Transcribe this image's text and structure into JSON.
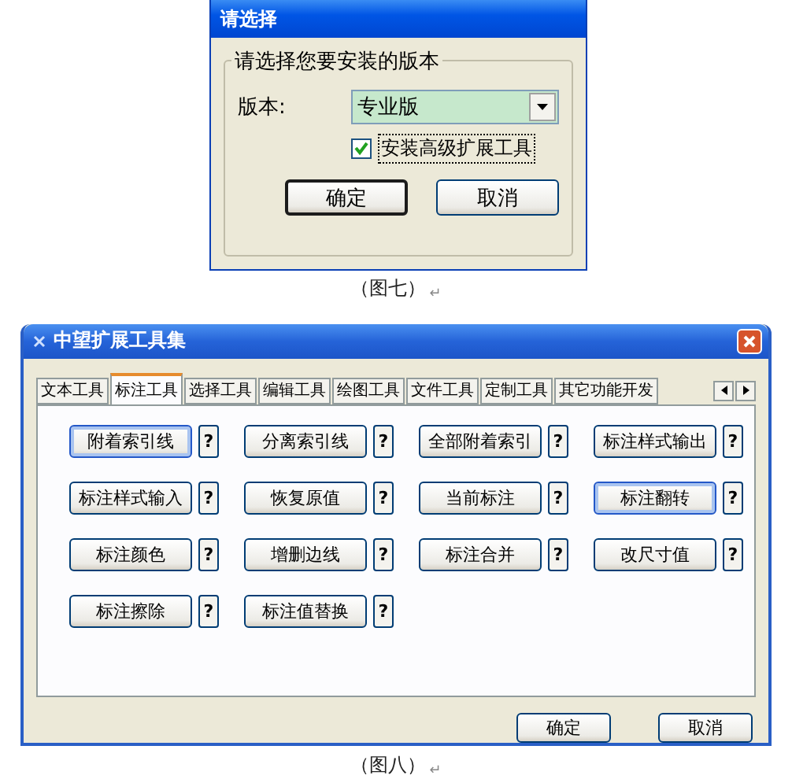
{
  "install_dialog": {
    "title": "请选择",
    "group_label": "请选择您要安装的版本",
    "version_label": "版本:",
    "version_value": "专业版",
    "checkbox": {
      "label": "安装高级扩展工具",
      "checked": true
    },
    "buttons": [
      {
        "label": "确定",
        "default": true
      },
      {
        "label": "取消",
        "default": false
      }
    ]
  },
  "caption_1": {
    "text": "（图七）",
    "mark": "↵"
  },
  "tools_dialog": {
    "title": "中望扩展工具集",
    "tabs": [
      {
        "label": "文本工具",
        "selected": false
      },
      {
        "label": "标注工具",
        "selected": true
      },
      {
        "label": "选择工具",
        "selected": false
      },
      {
        "label": "编辑工具",
        "selected": false
      },
      {
        "label": "绘图工具",
        "selected": false
      },
      {
        "label": "文件工具",
        "selected": false
      },
      {
        "label": "定制工具",
        "selected": false
      },
      {
        "label": "其它功能开发",
        "selected": false
      }
    ],
    "tools": [
      {
        "label": "附着索引线",
        "help": "?",
        "highlighted": true
      },
      {
        "label": "分离索引线",
        "help": "?",
        "highlighted": false
      },
      {
        "label": "全部附着索引",
        "help": "?",
        "highlighted": false
      },
      {
        "label": "标注样式输出",
        "help": "?",
        "highlighted": false
      },
      {
        "label": "标注样式输入",
        "help": "?",
        "highlighted": false
      },
      {
        "label": "恢复原值",
        "help": "?",
        "highlighted": false
      },
      {
        "label": "当前标注",
        "help": "?",
        "highlighted": false
      },
      {
        "label": "标注翻转",
        "help": "?",
        "highlighted": true
      },
      {
        "label": "标注颜色",
        "help": "?",
        "highlighted": false
      },
      {
        "label": "增删边线",
        "help": "?",
        "highlighted": false
      },
      {
        "label": "标注合并",
        "help": "?",
        "highlighted": false
      },
      {
        "label": "改尺寸值",
        "help": "?",
        "highlighted": false
      },
      {
        "label": "标注擦除",
        "help": "?",
        "highlighted": false
      },
      {
        "label": "标注值替换",
        "help": "?",
        "highlighted": false
      }
    ],
    "buttons": [
      {
        "label": "确定"
      },
      {
        "label": "取消"
      }
    ]
  },
  "caption_2": {
    "text": "（图八）",
    "mark": "↵"
  }
}
